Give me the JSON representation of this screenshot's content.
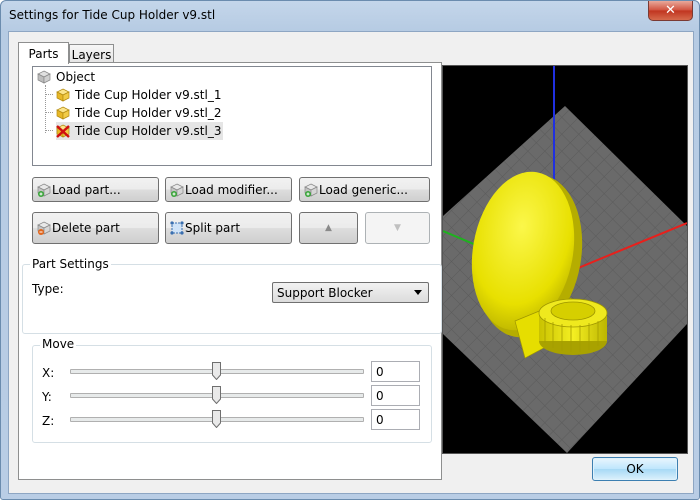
{
  "window": {
    "title": "Settings for Tide Cup Holder v9.stl",
    "close_label": "✕"
  },
  "tabs": [
    {
      "label": "Parts",
      "active": true
    },
    {
      "label": "Layers",
      "active": false
    }
  ],
  "tree": {
    "root": {
      "label": "Object",
      "icon": "object-cube-icon"
    },
    "items": [
      {
        "label": "Tide Cup Holder v9.stl_1",
        "icon": "part-cube-icon"
      },
      {
        "label": "Tide Cup Holder v9.stl_2",
        "icon": "part-cube-icon"
      },
      {
        "label": "Tide Cup Holder v9.stl_3",
        "icon": "support-blocker-icon"
      }
    ]
  },
  "buttons": {
    "load_part": "Load part...",
    "load_modifier": "Load modifier...",
    "load_generic": "Load generic...",
    "delete_part": "Delete part",
    "split_part": "Split part",
    "move_up": "▲",
    "move_down": "▼"
  },
  "part_settings": {
    "group_label": "Part Settings",
    "type_label": "Type:",
    "type_value": "Support Blocker"
  },
  "move": {
    "group_label": "Move",
    "axes": [
      {
        "label": "X:",
        "value": "0",
        "slider_fraction": 0.5
      },
      {
        "label": "Y:",
        "value": "0",
        "slider_fraction": 0.5
      },
      {
        "label": "Z:",
        "value": "0",
        "slider_fraction": 0.5
      }
    ]
  },
  "footer": {
    "ok_label": "OK"
  },
  "colors": {
    "model": "#f2ee00",
    "bed": "#6e6e6e",
    "x_axis": "#e8201c",
    "y_axis": "#1eb21e",
    "z_axis": "#2030e0"
  }
}
